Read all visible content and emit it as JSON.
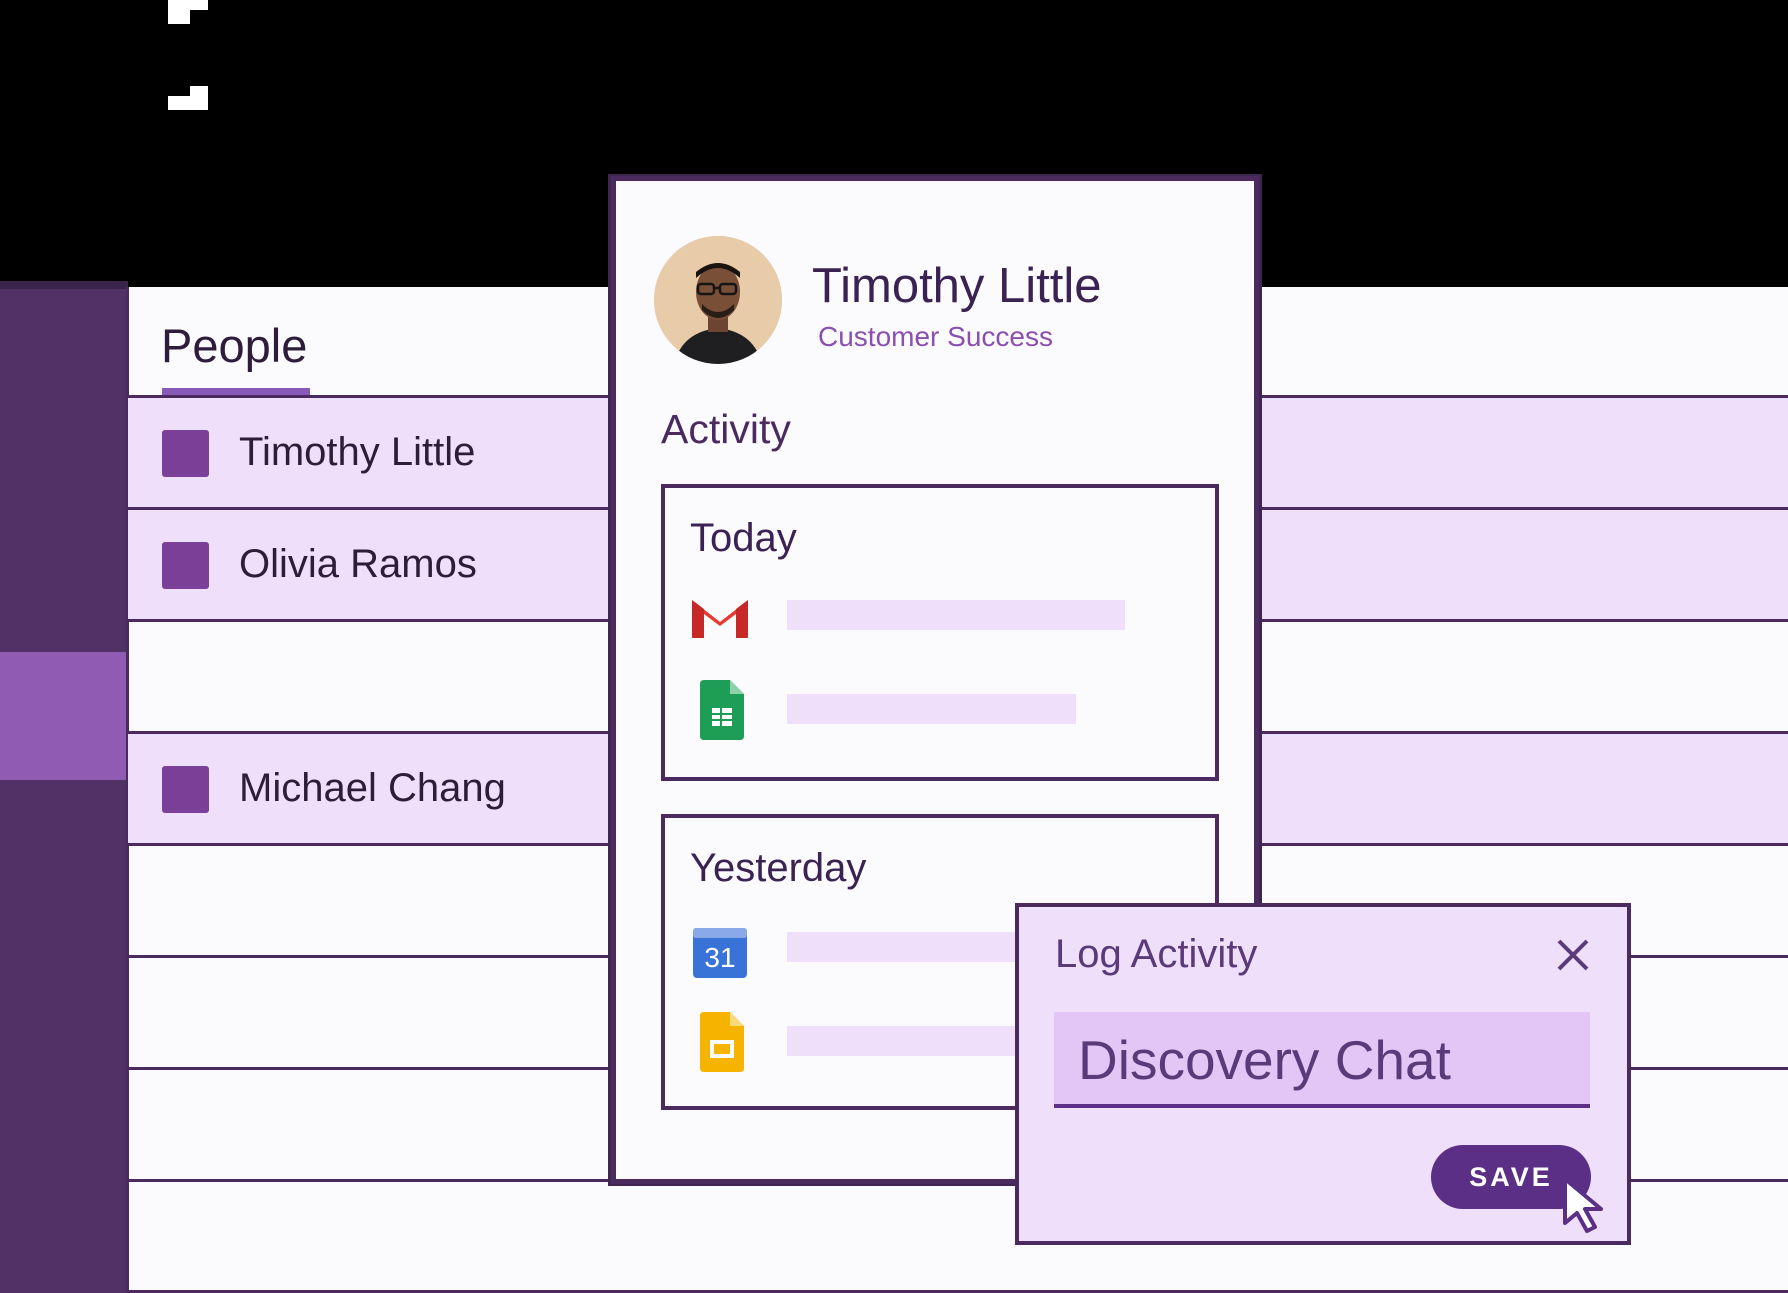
{
  "people": {
    "title": "People",
    "rows": [
      {
        "label": "Timothy Little"
      },
      {
        "label": "Olivia Ramos"
      },
      {
        "label": ""
      },
      {
        "label": "Michael Chang"
      }
    ]
  },
  "profile": {
    "name": "Timothy Little",
    "role": "Customer Success",
    "activity_title": "Activity",
    "groups": [
      {
        "heading": "Today",
        "items": [
          {
            "icon": "gmail-icon"
          },
          {
            "icon": "sheets-icon"
          }
        ]
      },
      {
        "heading": "Yesterday",
        "items": [
          {
            "icon": "calendar-icon",
            "icon_text": "31"
          },
          {
            "icon": "slides-icon"
          }
        ]
      }
    ]
  },
  "dialog": {
    "title": "Log Activity",
    "input_value": "Discovery Chat",
    "save_label": "SAVE"
  },
  "colors": {
    "accent": "#5a2f85",
    "row_fill": "#efdffb",
    "sidebar": "#523166"
  }
}
